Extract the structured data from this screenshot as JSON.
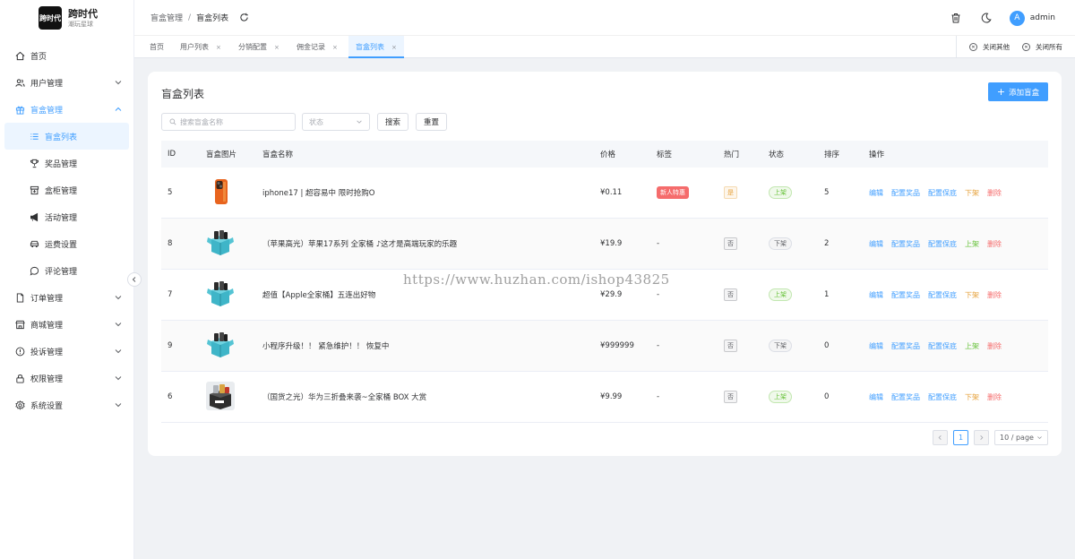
{
  "brand": {
    "logo_text": "跨时代",
    "title": "跨时代",
    "subtitle": "潮玩星球"
  },
  "sidebar": {
    "items": [
      {
        "label": "首页",
        "icon": "home-icon"
      },
      {
        "label": "用户管理",
        "icon": "users-icon"
      },
      {
        "label": "盲盒管理",
        "icon": "gift-icon"
      },
      {
        "label": "盲盒列表",
        "icon": "list-icon"
      },
      {
        "label": "奖品管理",
        "icon": "trophy-icon"
      },
      {
        "label": "盒柜管理",
        "icon": "box-icon"
      },
      {
        "label": "活动管理",
        "icon": "megaphone-icon"
      },
      {
        "label": "运费设置",
        "icon": "car-icon"
      },
      {
        "label": "评论管理",
        "icon": "chat-icon"
      },
      {
        "label": "订单管理",
        "icon": "document-icon"
      },
      {
        "label": "商城管理",
        "icon": "shop-icon"
      },
      {
        "label": "投诉管理",
        "icon": "alert-icon"
      },
      {
        "label": "权限管理",
        "icon": "lock-icon"
      },
      {
        "label": "系统设置",
        "icon": "gear-icon"
      }
    ]
  },
  "header": {
    "breadcrumb": [
      "盲盒管理",
      "盲盒列表"
    ],
    "username": "admin",
    "avatar_letter": "A"
  },
  "tabs": {
    "items": [
      "首页",
      "用户列表",
      "分销配置",
      "佣金记录",
      "盲盒列表"
    ],
    "close_others": "关闭其他",
    "close_all": "关闭所有"
  },
  "page": {
    "title": "盲盒列表",
    "add_button": "添加盲盒",
    "search_placeholder": "搜索盲盒名称",
    "status_placeholder": "状态",
    "search_button": "搜索",
    "reset_button": "重置"
  },
  "table": {
    "headers": [
      "ID",
      "盲盒图片",
      "盲盒名称",
      "价格",
      "标签",
      "热门",
      "状态",
      "排序",
      "操作"
    ],
    "rows": [
      {
        "id": "5",
        "name": "iphone17 | 超容易中 限时抢购O",
        "price": "¥0.11",
        "tag": "新人特惠",
        "hot": "是",
        "status": "上架",
        "sort": "5",
        "toggle": "下架"
      },
      {
        "id": "8",
        "name": "（苹果高光）苹果17系列 全家桶 ♪这才是高端玩家的乐趣",
        "price": "¥19.9",
        "tag": "-",
        "hot": "否",
        "status": "下架",
        "sort": "2",
        "toggle": "上架"
      },
      {
        "id": "7",
        "name": "超值【Apple全家桶】五连出好物",
        "price": "¥29.9",
        "tag": "-",
        "hot": "否",
        "status": "上架",
        "sort": "1",
        "toggle": "下架"
      },
      {
        "id": "9",
        "name": "小程序升级！！ 紧急维护！！ 恢复中",
        "price": "¥999999",
        "tag": "-",
        "hot": "否",
        "status": "下架",
        "sort": "0",
        "toggle": "上架"
      },
      {
        "id": "6",
        "name": "（国货之光）华为三折叠来袭~全家桶 BOX 大赏",
        "price": "¥9.99",
        "tag": "-",
        "hot": "否",
        "status": "上架",
        "sort": "0",
        "toggle": "下架"
      }
    ],
    "actions": {
      "edit": "编辑",
      "prizes": "配置奖品",
      "guarantee": "配置保底",
      "delete": "删除"
    }
  },
  "pagination": {
    "current": "1",
    "page_size": "10 / page"
  },
  "watermark": "https://www.huzhan.com/ishop43825",
  "colors": {
    "primary": "#409eff",
    "success": "#67c23a",
    "warning": "#e6a23c",
    "danger": "#f56c6c"
  }
}
